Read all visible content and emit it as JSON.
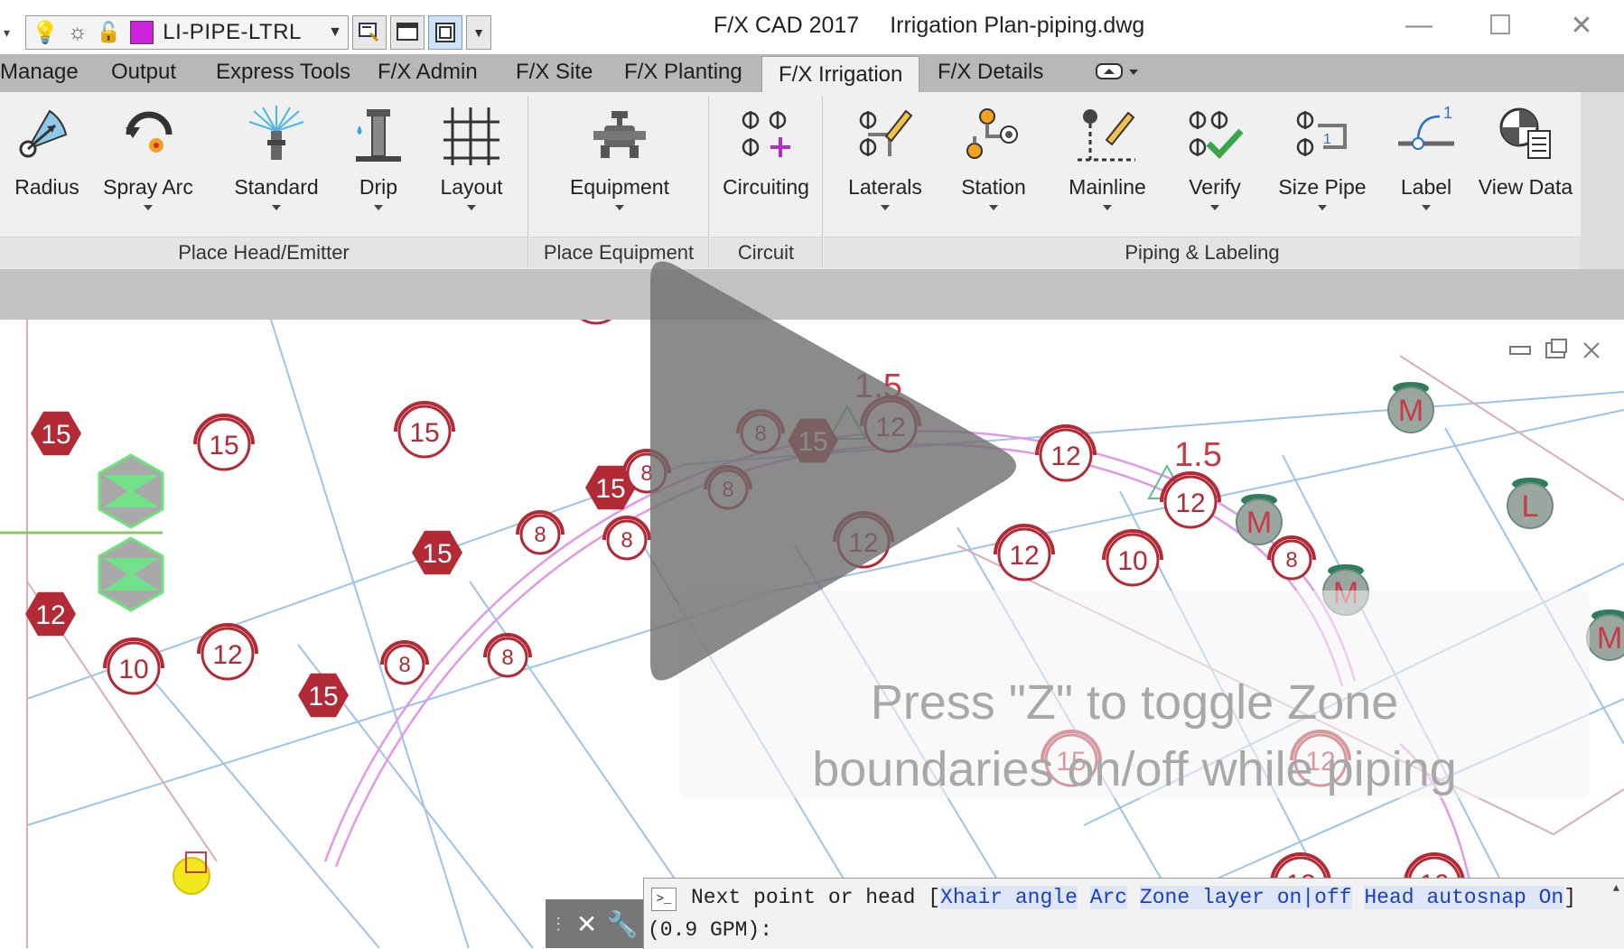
{
  "quick_access": {
    "layer_name": "LI-PIPE-LTRL"
  },
  "title": {
    "app": "F/X CAD 2017",
    "file": "Irrigation Plan-piping.dwg"
  },
  "tabs": [
    "Manage",
    "Output",
    "Express Tools",
    "F/X Admin",
    "F/X Site",
    "F/X Planting",
    "F/X Irrigation",
    "F/X Details"
  ],
  "active_tab": "F/X Irrigation",
  "ribbon": {
    "buttons": [
      {
        "label": "Radius",
        "icon": "radius-icon"
      },
      {
        "label": "Spray Arc",
        "icon": "spray-arc-icon"
      },
      {
        "label": "Standard",
        "icon": "sprinkler-icon"
      },
      {
        "label": "Drip",
        "icon": "drip-icon"
      },
      {
        "label": "Layout",
        "icon": "grid-icon"
      },
      {
        "label": "Equipment",
        "icon": "valve-icon"
      },
      {
        "label": "Circuiting",
        "icon": "circuiting-icon"
      },
      {
        "label": "Laterals",
        "icon": "laterals-icon"
      },
      {
        "label": "Station",
        "icon": "station-icon"
      },
      {
        "label": "Mainline",
        "icon": "mainline-icon"
      },
      {
        "label": "Verify",
        "icon": "verify-icon"
      },
      {
        "label": "Size Pipe",
        "icon": "size-pipe-icon"
      },
      {
        "label": "Label",
        "icon": "label-icon"
      },
      {
        "label": "View Data",
        "icon": "view-data-icon"
      }
    ],
    "panels": [
      "Place Head/Emitter",
      "Place Equipment",
      "Circuit",
      "Piping & Labeling"
    ]
  },
  "drawing": {
    "pipe_size_labels": [
      "1.5",
      "1.5"
    ],
    "hint_line1": "Press \"Z\" to toggle Zone",
    "hint_line2": "boundaries on/off while piping",
    "heads": [
      "15",
      "15",
      "15",
      "15",
      "15",
      "15",
      "15",
      "15",
      "15",
      "12",
      "12",
      "12",
      "12",
      "12",
      "12",
      "12",
      "12",
      "12",
      "10",
      "10",
      "10",
      "8",
      "8",
      "8",
      "8",
      "8",
      "8",
      "8",
      "8",
      "15",
      "12",
      "12",
      "10"
    ],
    "markers": [
      "M",
      "M",
      "M",
      "L",
      "M"
    ]
  },
  "command_line": {
    "prompt_start": "Next point or head [",
    "options": [
      "Xhair angle",
      "Arc",
      "Zone layer on|off",
      "Head autosnap On"
    ],
    "prompt_end": "]",
    "sub": "(0.9 GPM):"
  },
  "colors": {
    "head_red": "#b12a35",
    "marker_green": "#2f7d5a",
    "zone_grid": "#9ec3ea",
    "arc_pink": "#e099e8"
  }
}
